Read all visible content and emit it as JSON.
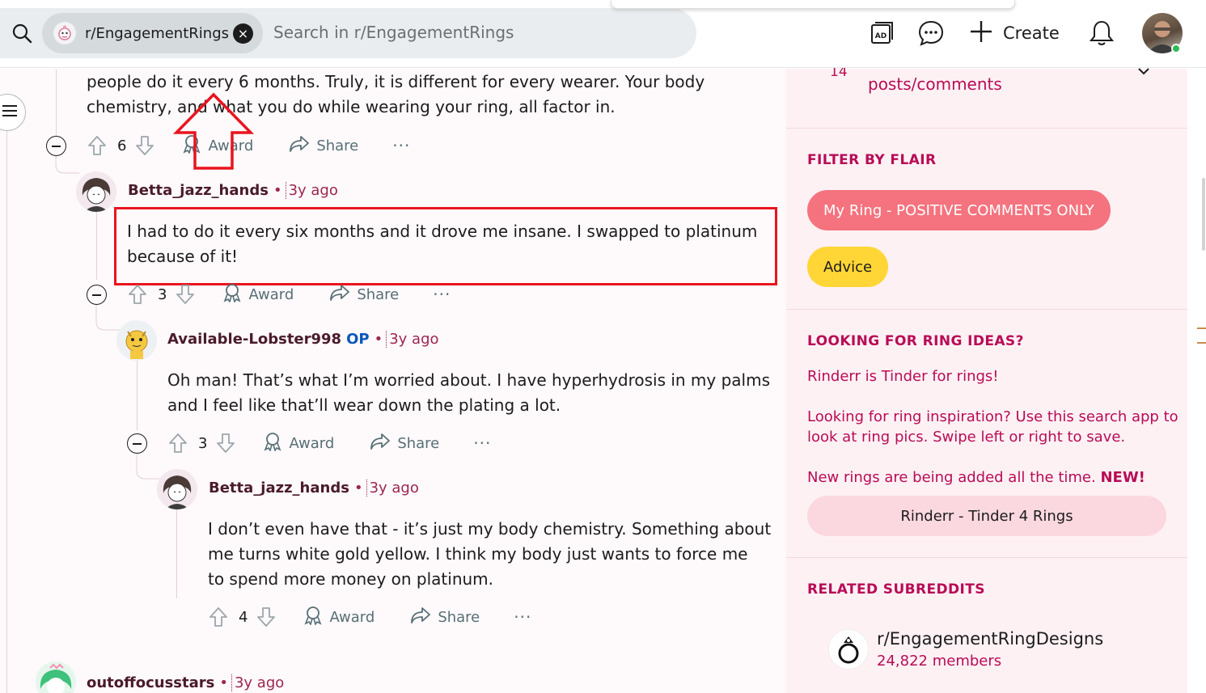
{
  "header": {
    "search_chip_label": "r/EngagementRings",
    "search_placeholder": "Search in r/EngagementRings",
    "create_label": "Create",
    "chip_close_glyph": "×"
  },
  "comments": [
    {
      "text_line1": "people do it every 6 months. Truly, it is different for every wearer. Your body",
      "text_line2": "chemistry, and what you do while wearing your ring, all factor in.",
      "votes": "6",
      "award": "Award",
      "share": "Share",
      "more": "···"
    },
    {
      "username": "Betta_jazz_hands",
      "dot": "•",
      "time": "3y ago",
      "text_line1": "I had to do it every six months and it drove me insane. I swapped to platinum",
      "text_line2": "because of it!",
      "votes": "3",
      "award": "Award",
      "share": "Share",
      "more": "···"
    },
    {
      "username": "Available-Lobster998",
      "op": "OP",
      "dot": "•",
      "time": "3y ago",
      "text_line1": "Oh man! That’s what I’m worried about. I have hyperhydrosis in my palms",
      "text_line2": "and I feel like that’ll wear down the plating a lot.",
      "votes": "3",
      "award": "Award",
      "share": "Share",
      "more": "···"
    },
    {
      "username": "Betta_jazz_hands",
      "dot": "•",
      "time": "3y ago",
      "text_line1": "I don’t even have that - it’s just my body chemistry. Something about",
      "text_line2": "me turns white gold yellow. I think my body just wants to force me",
      "text_line3": "to spend more money on platinum.",
      "votes": "4",
      "award": "Award",
      "share": "Share",
      "more": "···"
    },
    {
      "username": "outoffocusstars",
      "dot": "•",
      "time": "3y ago"
    }
  ],
  "sidebar": {
    "top_number": "14",
    "top_text": "posts/comments",
    "filter_heading": "FILTER BY FLAIR",
    "flairs": [
      "My Ring - POSITIVE COMMENTS ONLY",
      "Advice"
    ],
    "flair_colors": [
      "#f4737e",
      "#ffd635"
    ],
    "ideas_heading": "LOOKING FOR RING IDEAS?",
    "link1": "Rinderr is Tinder for rings!",
    "link2_line1": "Looking for ring inspiration? Use this search app to",
    "link2_line2": "look at ring pics. Swipe left or right to save.",
    "link3_text": "New rings are being added all the time.",
    "link3_new": "NEW!",
    "button_label": "Rinderr - Tinder 4 Rings",
    "related_heading": "RELATED SUBREDDITS",
    "related_name": "r/EngagementRingDesigns",
    "related_members": "24,822 members"
  },
  "colors": {
    "accent": "#b80c56",
    "highlight": "#e8141e"
  }
}
